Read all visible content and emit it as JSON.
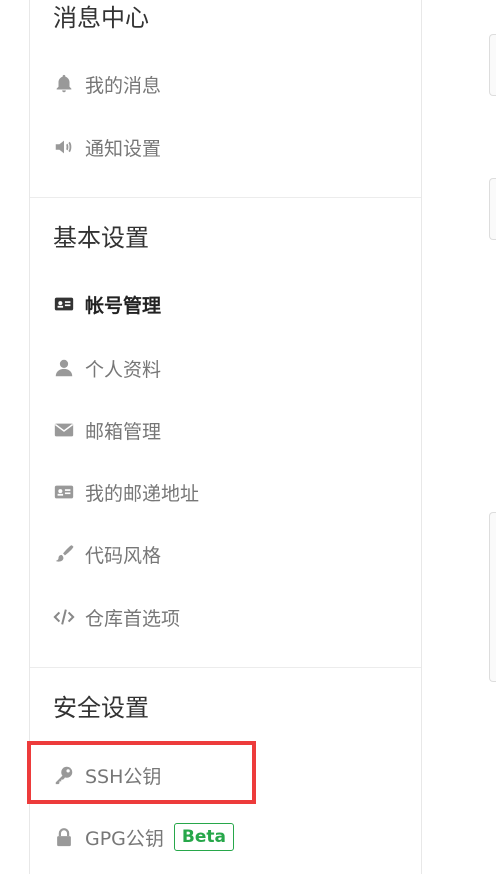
{
  "sections": [
    {
      "title": "消息中心",
      "items": [
        {
          "label": "我的消息",
          "icon": "bell-icon"
        },
        {
          "label": "通知设置",
          "icon": "speaker-icon"
        }
      ]
    },
    {
      "title": "基本设置",
      "items": [
        {
          "label": "帐号管理",
          "icon": "id-card-icon",
          "active": true
        },
        {
          "label": "个人资料",
          "icon": "user-icon"
        },
        {
          "label": "邮箱管理",
          "icon": "envelope-icon"
        },
        {
          "label": "我的邮递地址",
          "icon": "address-card-icon"
        },
        {
          "label": "代码风格",
          "icon": "brush-icon"
        },
        {
          "label": "仓库首选项",
          "icon": "code-icon"
        }
      ]
    },
    {
      "title": "安全设置",
      "items": [
        {
          "label": "SSH公钥",
          "icon": "key-icon"
        },
        {
          "label": "GPG公钥",
          "icon": "lock-icon",
          "badge": "Beta"
        }
      ]
    }
  ],
  "colors": {
    "accent_badge": "#27a74a",
    "highlight": "#ed3b3b",
    "muted_text": "#777777"
  }
}
